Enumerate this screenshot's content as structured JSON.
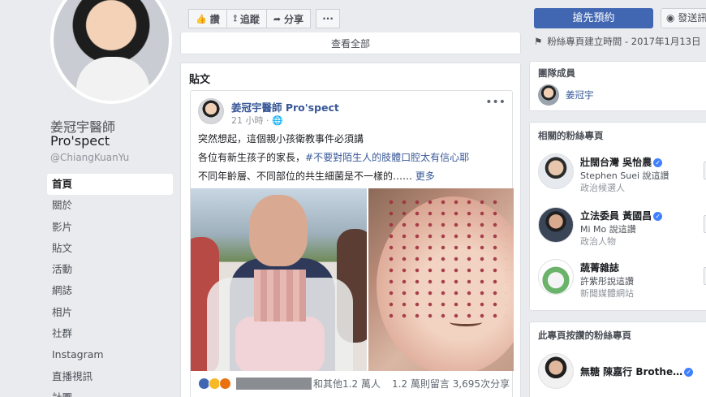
{
  "profile": {
    "name": "姜冠宇醫師",
    "name_line2": "Pro'spect",
    "handle": "@ChiangKuanYu"
  },
  "nav": [
    {
      "label": "首頁",
      "active": true
    },
    {
      "label": "關於"
    },
    {
      "label": "影片"
    },
    {
      "label": "貼文"
    },
    {
      "label": "活動"
    },
    {
      "label": "網誌"
    },
    {
      "label": "相片"
    },
    {
      "label": "社群"
    },
    {
      "label": "Instagram"
    },
    {
      "label": "直播視訊"
    },
    {
      "label": "計團"
    }
  ],
  "actions": {
    "like": "讚",
    "follow": "追蹤",
    "share": "分享",
    "more": "···"
  },
  "book_button": "搶先預約",
  "message_button": "發送訊息",
  "see_all": "查看全部",
  "posts": {
    "section_title": "貼文",
    "post": {
      "author": "姜冠宇醫師 Pro'spect",
      "time": "21 小時 · ",
      "line1": "突然想起，這個親小孩衛教事件必須講",
      "line2_prefix": "各位有新生孩子的家長，",
      "line2_hashtag": "#不要對陌生人的肢體口腔太有信心耶",
      "line3_prefix": "不同年齡層、不同部位的共生細菌是不一樣的…… ",
      "line3_more": "更多",
      "reactions_text": "和其他1.2 萬人",
      "comments_text": "1.2 萬則留言  3,695次分享"
    }
  },
  "right": {
    "founded": "粉絲專頁建立時間 - 2017年1月13日",
    "team_title": "團隊成員",
    "team_member": "姜冠宇",
    "related_title": "相關的粉絲專頁",
    "related": [
      {
        "name": "壯闊台灣 吳怡農",
        "sub": "Stephen Suei 說這讚",
        "sub2": "政治候選人",
        "verified": true
      },
      {
        "name": "立法委員 黃國昌",
        "sub": "Mi Mo 說這讚",
        "sub2": "政治人物",
        "verified": true
      },
      {
        "name": "蔬菁雜誌",
        "sub": "許紫彤說這讚",
        "sub2": "新聞媒體網站",
        "verified": false
      }
    ],
    "liked_title": "此專頁按讚的粉絲專頁",
    "liked": [
      {
        "name": "無糖 陳嘉行 Brothe…",
        "verified": true
      }
    ]
  },
  "colors": {
    "primary": "#4267b2",
    "link": "#385898",
    "background": "#e9ebee"
  }
}
